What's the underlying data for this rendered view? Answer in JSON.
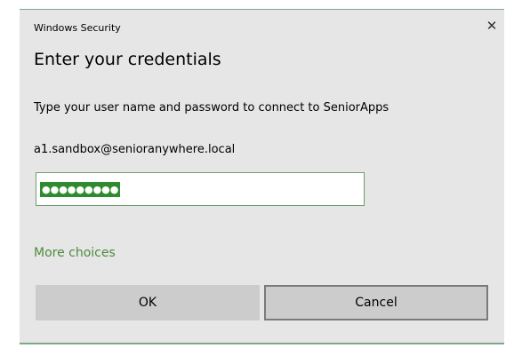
{
  "window": {
    "title": "Windows Security",
    "close_glyph": "✕"
  },
  "dialog": {
    "heading": "Enter your credentials",
    "description": "Type your user name and password to connect to SeniorApps",
    "username": "a1.sandbox@senioranywhere.local",
    "password_masked": "●●●●●●●●●",
    "more_choices": "More choices"
  },
  "buttons": {
    "ok_label": "OK",
    "cancel_label": "Cancel"
  },
  "colors": {
    "accent_green": "#4e8a3e",
    "selection_green": "#2e8b2e",
    "dialog_background": "#e6e6e6",
    "button_background": "#cccccc"
  }
}
